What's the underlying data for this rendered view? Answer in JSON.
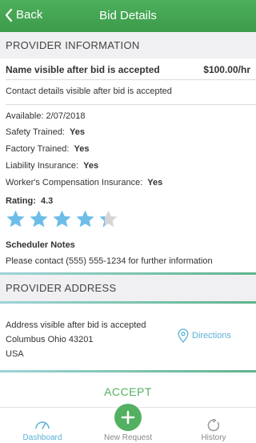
{
  "header": {
    "back_label": "Back",
    "title": "Bid Details"
  },
  "provider_info": {
    "section_title": "PROVIDER INFORMATION",
    "name": "Name visible after bid is accepted",
    "rate": "$100.00/hr",
    "contact": "Contact details visible after bid is accepted",
    "available": "Available: 2/07/2018",
    "attributes": [
      {
        "label": "Safety Trained:",
        "value": "Yes"
      },
      {
        "label": "Factory Trained:",
        "value": "Yes"
      },
      {
        "label": "Liability Insurance:",
        "value": "Yes"
      },
      {
        "label": "Worker's Compensation Insurance:",
        "value": "Yes"
      }
    ],
    "rating_label": "Rating:",
    "rating_value": "4.3",
    "rating_stars": 4.3,
    "notes_title": "Scheduler Notes",
    "notes_text": "Please contact (555) 555-1234 for further information"
  },
  "provider_address": {
    "section_title": "PROVIDER ADDRESS",
    "line1": "Address visible after bid is accepted",
    "line2": "Columbus  Ohio 43201",
    "line3": "USA",
    "directions_label": "Directions"
  },
  "accept_label": "ACCEPT",
  "tabs": {
    "dashboard": "Dashboard",
    "new_request": "New Request",
    "history": "History"
  },
  "colors": {
    "brand_green": "#4caf5a",
    "star_blue": "#6dbde8",
    "link_blue": "#5ab0d6"
  }
}
